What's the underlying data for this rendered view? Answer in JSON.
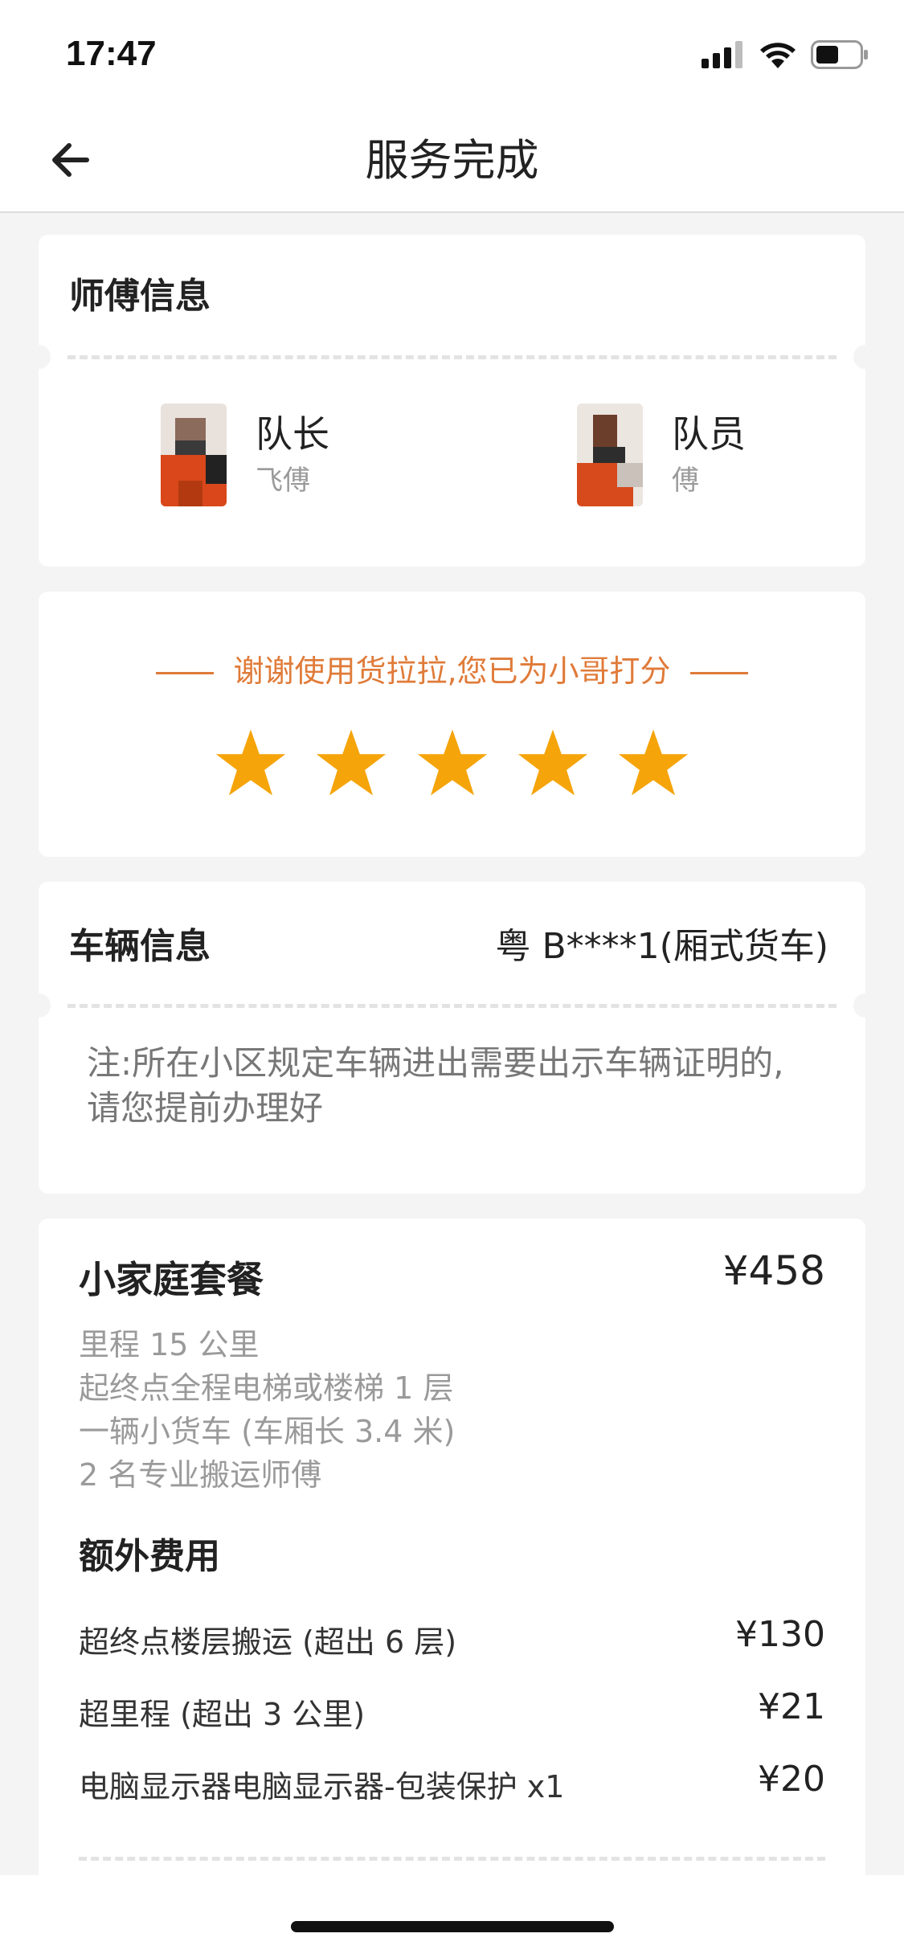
{
  "status_bar": {
    "time": "17:47"
  },
  "header": {
    "title": "服务完成"
  },
  "workers_card": {
    "title": "师傅信息",
    "workers": [
      {
        "role": "队长",
        "name": "飞傅"
      },
      {
        "role": "队员",
        "name": "傅"
      }
    ]
  },
  "rating_card": {
    "text": "谢谢使用货拉拉,您已为小哥打分",
    "stars": 5,
    "star_color": "#f5a40a"
  },
  "vehicle_card": {
    "title": "车辆信息",
    "plate": "粤 B****1(厢式货车)",
    "note": "注:所在小区规定车辆进出需要出示车辆证明的,请您提前办理好"
  },
  "package_card": {
    "name": "小家庭套餐",
    "price": "¥458",
    "details": [
      "里程 15 公里",
      "起终点全程电梯或楼梯 1 层",
      "一辆小货车 (车厢长 3.4 米)",
      "2 名专业搬运师傅"
    ],
    "extra_title": "额外费用",
    "fees": [
      {
        "label": "超终点楼层搬运 (超出 6 层)",
        "amount": "¥130"
      },
      {
        "label": "超里程 (超出 3 公里)",
        "amount": "¥21"
      },
      {
        "label": "电脑显示器电脑显示器-包装保护 x1",
        "amount": "¥20"
      }
    ]
  },
  "colors": {
    "accent": "#e07b39",
    "star": "#f5a40a",
    "background": "#f4f4f4"
  }
}
